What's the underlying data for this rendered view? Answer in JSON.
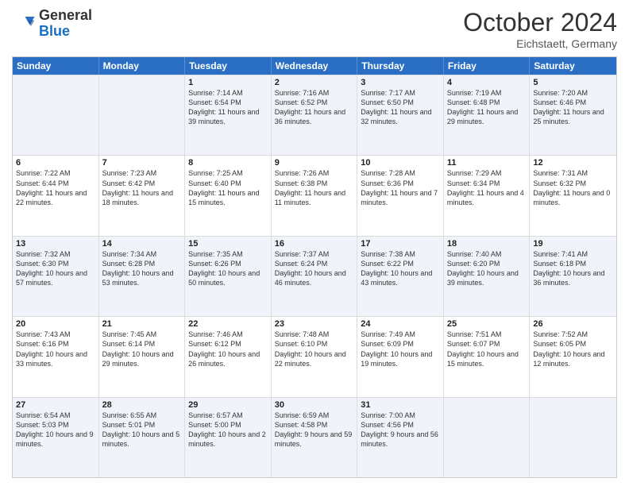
{
  "header": {
    "logo_general": "General",
    "logo_blue": "Blue",
    "month": "October 2024",
    "location": "Eichstaett, Germany"
  },
  "days_of_week": [
    "Sunday",
    "Monday",
    "Tuesday",
    "Wednesday",
    "Thursday",
    "Friday",
    "Saturday"
  ],
  "rows": [
    [
      {
        "day": "",
        "text": ""
      },
      {
        "day": "",
        "text": ""
      },
      {
        "day": "1",
        "text": "Sunrise: 7:14 AM\nSunset: 6:54 PM\nDaylight: 11 hours and 39 minutes."
      },
      {
        "day": "2",
        "text": "Sunrise: 7:16 AM\nSunset: 6:52 PM\nDaylight: 11 hours and 36 minutes."
      },
      {
        "day": "3",
        "text": "Sunrise: 7:17 AM\nSunset: 6:50 PM\nDaylight: 11 hours and 32 minutes."
      },
      {
        "day": "4",
        "text": "Sunrise: 7:19 AM\nSunset: 6:48 PM\nDaylight: 11 hours and 29 minutes."
      },
      {
        "day": "5",
        "text": "Sunrise: 7:20 AM\nSunset: 6:46 PM\nDaylight: 11 hours and 25 minutes."
      }
    ],
    [
      {
        "day": "6",
        "text": "Sunrise: 7:22 AM\nSunset: 6:44 PM\nDaylight: 11 hours and 22 minutes."
      },
      {
        "day": "7",
        "text": "Sunrise: 7:23 AM\nSunset: 6:42 PM\nDaylight: 11 hours and 18 minutes."
      },
      {
        "day": "8",
        "text": "Sunrise: 7:25 AM\nSunset: 6:40 PM\nDaylight: 11 hours and 15 minutes."
      },
      {
        "day": "9",
        "text": "Sunrise: 7:26 AM\nSunset: 6:38 PM\nDaylight: 11 hours and 11 minutes."
      },
      {
        "day": "10",
        "text": "Sunrise: 7:28 AM\nSunset: 6:36 PM\nDaylight: 11 hours and 7 minutes."
      },
      {
        "day": "11",
        "text": "Sunrise: 7:29 AM\nSunset: 6:34 PM\nDaylight: 11 hours and 4 minutes."
      },
      {
        "day": "12",
        "text": "Sunrise: 7:31 AM\nSunset: 6:32 PM\nDaylight: 11 hours and 0 minutes."
      }
    ],
    [
      {
        "day": "13",
        "text": "Sunrise: 7:32 AM\nSunset: 6:30 PM\nDaylight: 10 hours and 57 minutes."
      },
      {
        "day": "14",
        "text": "Sunrise: 7:34 AM\nSunset: 6:28 PM\nDaylight: 10 hours and 53 minutes."
      },
      {
        "day": "15",
        "text": "Sunrise: 7:35 AM\nSunset: 6:26 PM\nDaylight: 10 hours and 50 minutes."
      },
      {
        "day": "16",
        "text": "Sunrise: 7:37 AM\nSunset: 6:24 PM\nDaylight: 10 hours and 46 minutes."
      },
      {
        "day": "17",
        "text": "Sunrise: 7:38 AM\nSunset: 6:22 PM\nDaylight: 10 hours and 43 minutes."
      },
      {
        "day": "18",
        "text": "Sunrise: 7:40 AM\nSunset: 6:20 PM\nDaylight: 10 hours and 39 minutes."
      },
      {
        "day": "19",
        "text": "Sunrise: 7:41 AM\nSunset: 6:18 PM\nDaylight: 10 hours and 36 minutes."
      }
    ],
    [
      {
        "day": "20",
        "text": "Sunrise: 7:43 AM\nSunset: 6:16 PM\nDaylight: 10 hours and 33 minutes."
      },
      {
        "day": "21",
        "text": "Sunrise: 7:45 AM\nSunset: 6:14 PM\nDaylight: 10 hours and 29 minutes."
      },
      {
        "day": "22",
        "text": "Sunrise: 7:46 AM\nSunset: 6:12 PM\nDaylight: 10 hours and 26 minutes."
      },
      {
        "day": "23",
        "text": "Sunrise: 7:48 AM\nSunset: 6:10 PM\nDaylight: 10 hours and 22 minutes."
      },
      {
        "day": "24",
        "text": "Sunrise: 7:49 AM\nSunset: 6:09 PM\nDaylight: 10 hours and 19 minutes."
      },
      {
        "day": "25",
        "text": "Sunrise: 7:51 AM\nSunset: 6:07 PM\nDaylight: 10 hours and 15 minutes."
      },
      {
        "day": "26",
        "text": "Sunrise: 7:52 AM\nSunset: 6:05 PM\nDaylight: 10 hours and 12 minutes."
      }
    ],
    [
      {
        "day": "27",
        "text": "Sunrise: 6:54 AM\nSunset: 5:03 PM\nDaylight: 10 hours and 9 minutes."
      },
      {
        "day": "28",
        "text": "Sunrise: 6:55 AM\nSunset: 5:01 PM\nDaylight: 10 hours and 5 minutes."
      },
      {
        "day": "29",
        "text": "Sunrise: 6:57 AM\nSunset: 5:00 PM\nDaylight: 10 hours and 2 minutes."
      },
      {
        "day": "30",
        "text": "Sunrise: 6:59 AM\nSunset: 4:58 PM\nDaylight: 9 hours and 59 minutes."
      },
      {
        "day": "31",
        "text": "Sunrise: 7:00 AM\nSunset: 4:56 PM\nDaylight: 9 hours and 56 minutes."
      },
      {
        "day": "",
        "text": ""
      },
      {
        "day": "",
        "text": ""
      }
    ]
  ],
  "alt_rows": [
    0,
    2,
    4
  ]
}
